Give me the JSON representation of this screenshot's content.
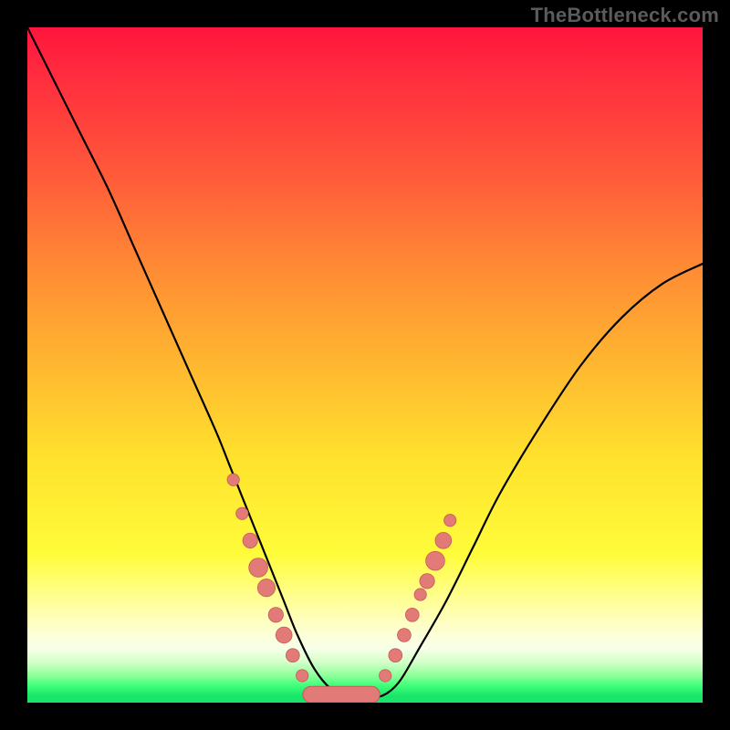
{
  "attribution": "TheBottleneck.com",
  "colors": {
    "frame": "#000000",
    "curve": "#000000",
    "marker_fill": "#e27b78",
    "marker_stroke": "#c55a57",
    "gradient_top": "#ff153d",
    "gradient_bottom": "#18e56a"
  },
  "chart_data": {
    "type": "line",
    "title": "",
    "xlabel": "",
    "ylabel": "",
    "xlim": [
      0,
      100
    ],
    "ylim": [
      0,
      100
    ],
    "grid": false,
    "legend": null,
    "series": [
      {
        "name": "bottleneck-curve",
        "x": [
          0,
          4,
          8,
          12,
          16,
          20,
          24,
          28,
          30,
          32,
          34,
          36,
          38,
          40,
          42.5,
          45,
          47.5,
          50,
          52.5,
          55,
          58,
          62,
          66,
          70,
          76,
          82,
          88,
          94,
          100
        ],
        "y": [
          100,
          92,
          84,
          76,
          67,
          58,
          49,
          40,
          35,
          30,
          25,
          20,
          15,
          10,
          5,
          2,
          1,
          1,
          1,
          3,
          8,
          15,
          23,
          31,
          41,
          50,
          57,
          62,
          65
        ]
      }
    ],
    "markers_left": [
      {
        "x": 30.5,
        "y": 33,
        "r": 0.9
      },
      {
        "x": 31.8,
        "y": 28,
        "r": 0.9
      },
      {
        "x": 33.0,
        "y": 24,
        "r": 1.1
      },
      {
        "x": 34.2,
        "y": 20,
        "r": 1.4
      },
      {
        "x": 35.4,
        "y": 17,
        "r": 1.3
      },
      {
        "x": 36.8,
        "y": 13,
        "r": 1.1
      },
      {
        "x": 38.0,
        "y": 10,
        "r": 1.2
      },
      {
        "x": 39.3,
        "y": 7,
        "r": 1.0
      },
      {
        "x": 40.7,
        "y": 4,
        "r": 0.9
      }
    ],
    "markers_right": [
      {
        "x": 53.0,
        "y": 4,
        "r": 0.9
      },
      {
        "x": 54.5,
        "y": 7,
        "r": 1.0
      },
      {
        "x": 55.8,
        "y": 10,
        "r": 1.0
      },
      {
        "x": 57.0,
        "y": 13,
        "r": 1.0
      },
      {
        "x": 58.2,
        "y": 16,
        "r": 0.9
      },
      {
        "x": 59.2,
        "y": 18,
        "r": 1.1
      },
      {
        "x": 60.4,
        "y": 21,
        "r": 1.4
      },
      {
        "x": 61.6,
        "y": 24,
        "r": 1.2
      },
      {
        "x": 62.6,
        "y": 27,
        "r": 0.9
      }
    ],
    "bottom_lozenge": {
      "x_start": 42,
      "x_end": 51,
      "y": 1.2,
      "r": 1.2
    }
  }
}
